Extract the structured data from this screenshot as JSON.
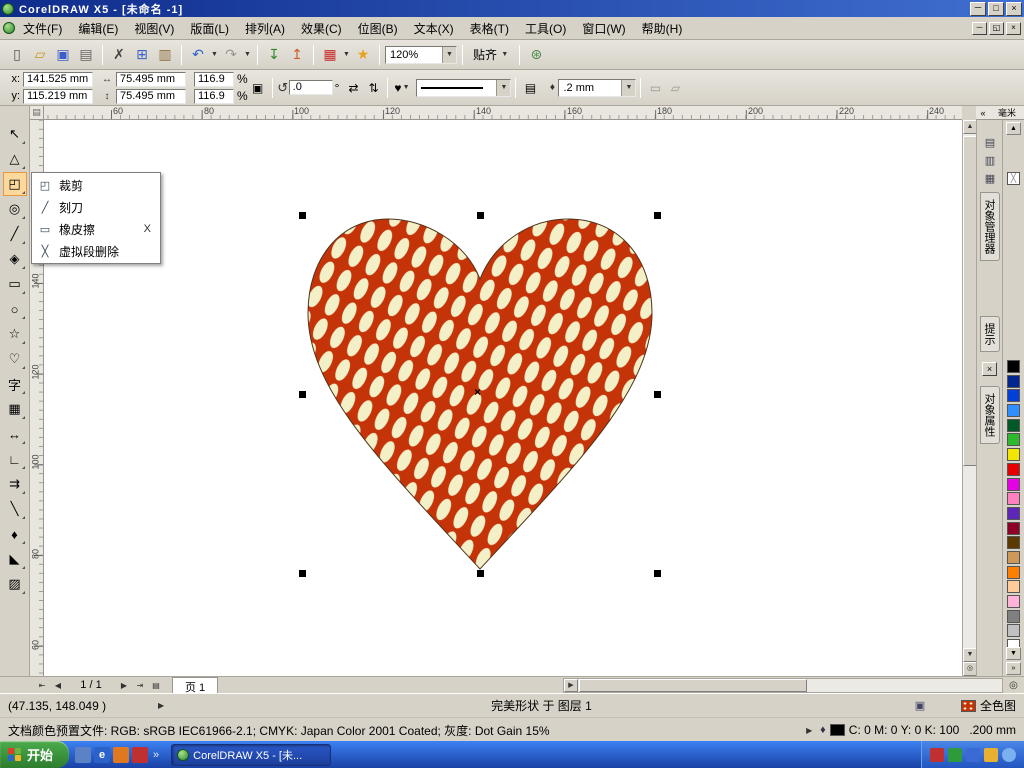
{
  "window": {
    "title": "CorelDRAW X5 - [未命名 -1]",
    "controls": {
      "minimize": "－",
      "maximize": "□",
      "close": "×"
    }
  },
  "menubar": {
    "items": [
      "文件(F)",
      "编辑(E)",
      "视图(V)",
      "版面(L)",
      "排列(A)",
      "效果(C)",
      "位图(B)",
      "文本(X)",
      "表格(T)",
      "工具(O)",
      "窗口(W)",
      "帮助(H)"
    ],
    "doc_controls": {
      "minimize": "－",
      "restore": "◱",
      "close": "×"
    }
  },
  "standard_toolbar": {
    "icons": [
      {
        "name": "new-document-button",
        "glyph": "▯"
      },
      {
        "name": "open-button",
        "glyph": "▱"
      },
      {
        "name": "save-button",
        "glyph": "▣"
      },
      {
        "name": "print-button",
        "glyph": "▤"
      },
      {
        "name": "cut-button",
        "glyph": "✗"
      },
      {
        "name": "copy-button",
        "glyph": "⊞"
      },
      {
        "name": "paste-button",
        "glyph": "▥"
      },
      {
        "name": "undo-button",
        "glyph": "↶"
      },
      {
        "name": "redo-button",
        "glyph": "↷"
      },
      {
        "name": "import-button",
        "glyph": "↧"
      },
      {
        "name": "export-button",
        "glyph": "↥"
      },
      {
        "name": "app-launcher-button",
        "glyph": "▦"
      },
      {
        "name": "welcome-screen-button",
        "glyph": "★"
      },
      {
        "name": "options-button",
        "glyph": "⊛"
      }
    ],
    "dropdown_glyph": "▼",
    "zoom_value": "120%",
    "snap_label": "贴齐"
  },
  "property_bar": {
    "x_label": "x:",
    "x_value": "141.525 mm",
    "y_label": "y:",
    "y_value": "115.219 mm",
    "width_icon": "↔",
    "width_value": "75.495 mm",
    "height_icon": "↕",
    "height_value": "75.495 mm",
    "scale_x_value": "116.9",
    "scale_y_value": "116.9",
    "percent_label": "%",
    "lock_glyph": "▣",
    "rotation_icon": "↺",
    "rotation_value": ".0",
    "degree_label": "°",
    "mirror_h_glyph": "⇄",
    "mirror_v_glyph": "⇅",
    "shape_glyph": "♥",
    "wrap_glyph": "▤",
    "pen_glyph": "♦",
    "outline_width_value": ".2 mm",
    "extra1_glyph": "▭",
    "extra2_glyph": "▱"
  },
  "toolbox": {
    "tools": [
      {
        "name": "pick-tool",
        "glyph": "↖"
      },
      {
        "name": "shape-tool",
        "glyph": "△"
      },
      {
        "name": "crop-tool",
        "glyph": "◰"
      },
      {
        "name": "zoom-tool",
        "glyph": "◎"
      },
      {
        "name": "freehand-tool",
        "glyph": "╱"
      },
      {
        "name": "smart-fill-tool",
        "glyph": "◈"
      },
      {
        "name": "rectangle-tool",
        "glyph": "▭"
      },
      {
        "name": "ellipse-tool",
        "glyph": "○"
      },
      {
        "name": "polygon-tool",
        "glyph": "☆"
      },
      {
        "name": "basic-shapes-tool",
        "glyph": "♡"
      },
      {
        "name": "text-tool",
        "glyph": "字"
      },
      {
        "name": "table-tool",
        "glyph": "▦"
      },
      {
        "name": "dimension-tool",
        "glyph": "↔"
      },
      {
        "name": "connector-tool",
        "glyph": "∟"
      },
      {
        "name": "blend-tool",
        "glyph": "⇉"
      },
      {
        "name": "eyedropper-tool",
        "glyph": "╲"
      },
      {
        "name": "outline-pen-tool",
        "glyph": "♦"
      },
      {
        "name": "fill-tool",
        "glyph": "◣"
      },
      {
        "name": "interactive-fill-tool",
        "glyph": "▨"
      }
    ]
  },
  "flyout_menu": {
    "items": [
      {
        "label": "裁剪",
        "glyph": "◰",
        "shortcut": ""
      },
      {
        "label": "刻刀",
        "glyph": "╱",
        "shortcut": ""
      },
      {
        "label": "橡皮擦",
        "glyph": "▭",
        "shortcut": "X"
      },
      {
        "label": "虚拟段删除",
        "glyph": "╳",
        "shortcut": ""
      }
    ]
  },
  "rulers": {
    "unit": "毫米",
    "origin_glyph": "▤",
    "top_numbers": [
      "60",
      "80",
      "100",
      "120",
      "140",
      "160",
      "180",
      "200",
      "220",
      "240"
    ],
    "left_numbers": [
      "140",
      "120",
      "100",
      "80",
      "60"
    ]
  },
  "canvas": {
    "selection_center_mark": "×",
    "heart": {
      "pattern_background": "#c53409",
      "pattern_spots": "#f3efc7",
      "outline_color": "#4d3319"
    }
  },
  "dockers": {
    "collapse_glyph": "«",
    "close_glyph": "×",
    "tabs": [
      "对象管理器",
      "提示",
      "对象属性"
    ]
  },
  "palette": {
    "scroll_up_glyph": "▲",
    "scroll_down_glyph": "▼",
    "expand_glyph": "»",
    "no_fill_glyph": "╳",
    "colors": [
      "#000000",
      "#00268f",
      "#0040d9",
      "#2f8fff",
      "#005926",
      "#2eb82e",
      "#f2e600",
      "#e60000",
      "#e600e6",
      "#ff80c0",
      "#5c26b8",
      "#8f0026",
      "#5c3900",
      "#cc9959",
      "#ff8000",
      "#ffcc99",
      "#ffb3d9",
      "#808080",
      "#c0c0c0",
      "#ffffff"
    ]
  },
  "scrollbars": {
    "up": "▲",
    "down": "▼",
    "left": "◀",
    "right": "▶",
    "navigator": "◎"
  },
  "page_controls": {
    "first_glyph": "⇤",
    "prev_glyph": "◀",
    "indicator": "1 / 1",
    "next_glyph": "▶",
    "last_glyph": "⇥",
    "add_page_glyph": "▤",
    "page_tab": "页 1"
  },
  "status_bar": {
    "coordinates": "(47.135, 148.049 )",
    "flyout_arrow": "▶",
    "object_info": "完美形状 于 图层 1",
    "preview_glyph": "▣",
    "color_profile": "文档颜色预置文件: RGB: sRGB IEC61966-2.1; CMYK: Japan Color 2001 Coated; 灰度: Dot Gain 15%",
    "fill_label": "全色图",
    "pen_glyph": "♦",
    "outline_color_text": "C: 0 M: 0 Y: 0 K: 100",
    "outline_width_text": ".200 mm"
  },
  "taskbar": {
    "start_label": "开始",
    "ie_glyph": "e",
    "overflow_glyph": "»",
    "task_button_label": "CorelDRAW X5 - [未..."
  }
}
